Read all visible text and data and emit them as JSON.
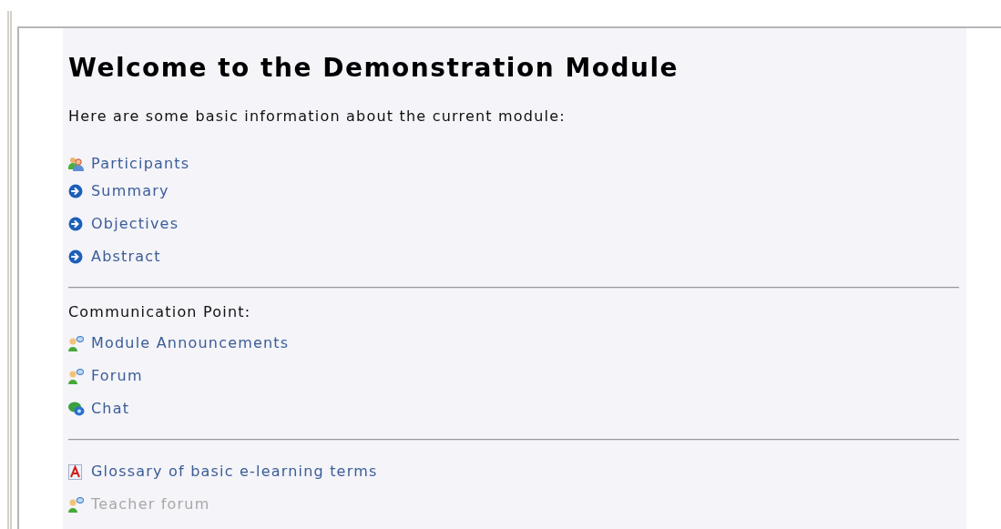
{
  "title": "Welcome to the Demonstration Module",
  "intro": "Here are some basic information about the current module:",
  "sections": [
    {
      "items": [
        {
          "label": "Participants",
          "kind": "people",
          "disabled": false
        },
        {
          "label": "Summary",
          "kind": "page",
          "disabled": false
        },
        {
          "label": "Objectives",
          "kind": "page",
          "disabled": false
        },
        {
          "label": "Abstract",
          "kind": "page",
          "disabled": false
        }
      ]
    },
    {
      "heading": "Communication Point:",
      "items": [
        {
          "label": "Module Announcements",
          "kind": "forum",
          "disabled": false
        },
        {
          "label": "Forum",
          "kind": "forum",
          "disabled": false
        },
        {
          "label": "Chat",
          "kind": "chat",
          "disabled": false
        }
      ]
    },
    {
      "items": [
        {
          "label": "Glossary of basic e-learning terms",
          "kind": "glossary",
          "disabled": false
        },
        {
          "label": "Teacher forum",
          "kind": "forum",
          "disabled": true
        }
      ]
    }
  ]
}
